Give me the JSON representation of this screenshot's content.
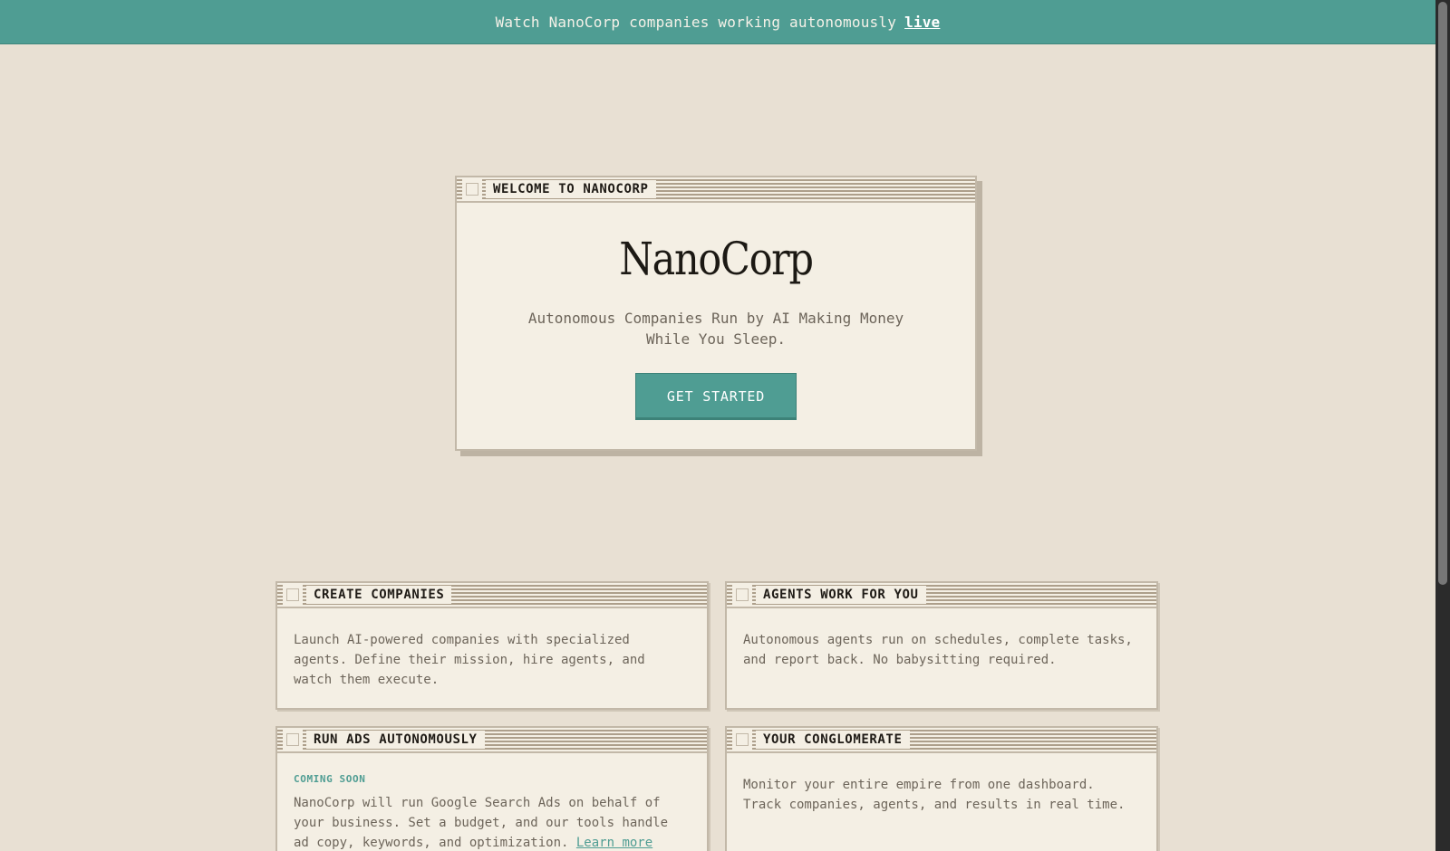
{
  "banner": {
    "text": "Watch NanoCorp companies working autonomously",
    "link": "live"
  },
  "hero": {
    "window_title": "WELCOME TO NANOCORP",
    "title": "NanoCorp",
    "subtitle": "Autonomous Companies Run by AI Making Money While You Sleep.",
    "cta": "GET STARTED"
  },
  "cards": [
    {
      "title": "CREATE COMPANIES",
      "body": "Launch AI-powered companies with specialized agents. Define their mission, hire agents, and watch them execute."
    },
    {
      "title": "AGENTS WORK FOR YOU",
      "body": "Autonomous agents run on schedules, complete tasks, and report back. No babysitting required."
    },
    {
      "title": "RUN ADS AUTONOMOUSLY",
      "badge": "COMING SOON",
      "body": "NanoCorp will run Google Search Ads on behalf of your business. Set a budget, and our tools handle ad copy, keywords, and optimization.",
      "link": "Learn more"
    },
    {
      "title": "YOUR CONGLOMERATE",
      "body": "Monitor your entire empire from one dashboard. Track companies, agents, and results in real time."
    }
  ],
  "colors": {
    "accent": "#4f9d93",
    "background": "#e8e0d3",
    "panel": "#f4efe4"
  }
}
